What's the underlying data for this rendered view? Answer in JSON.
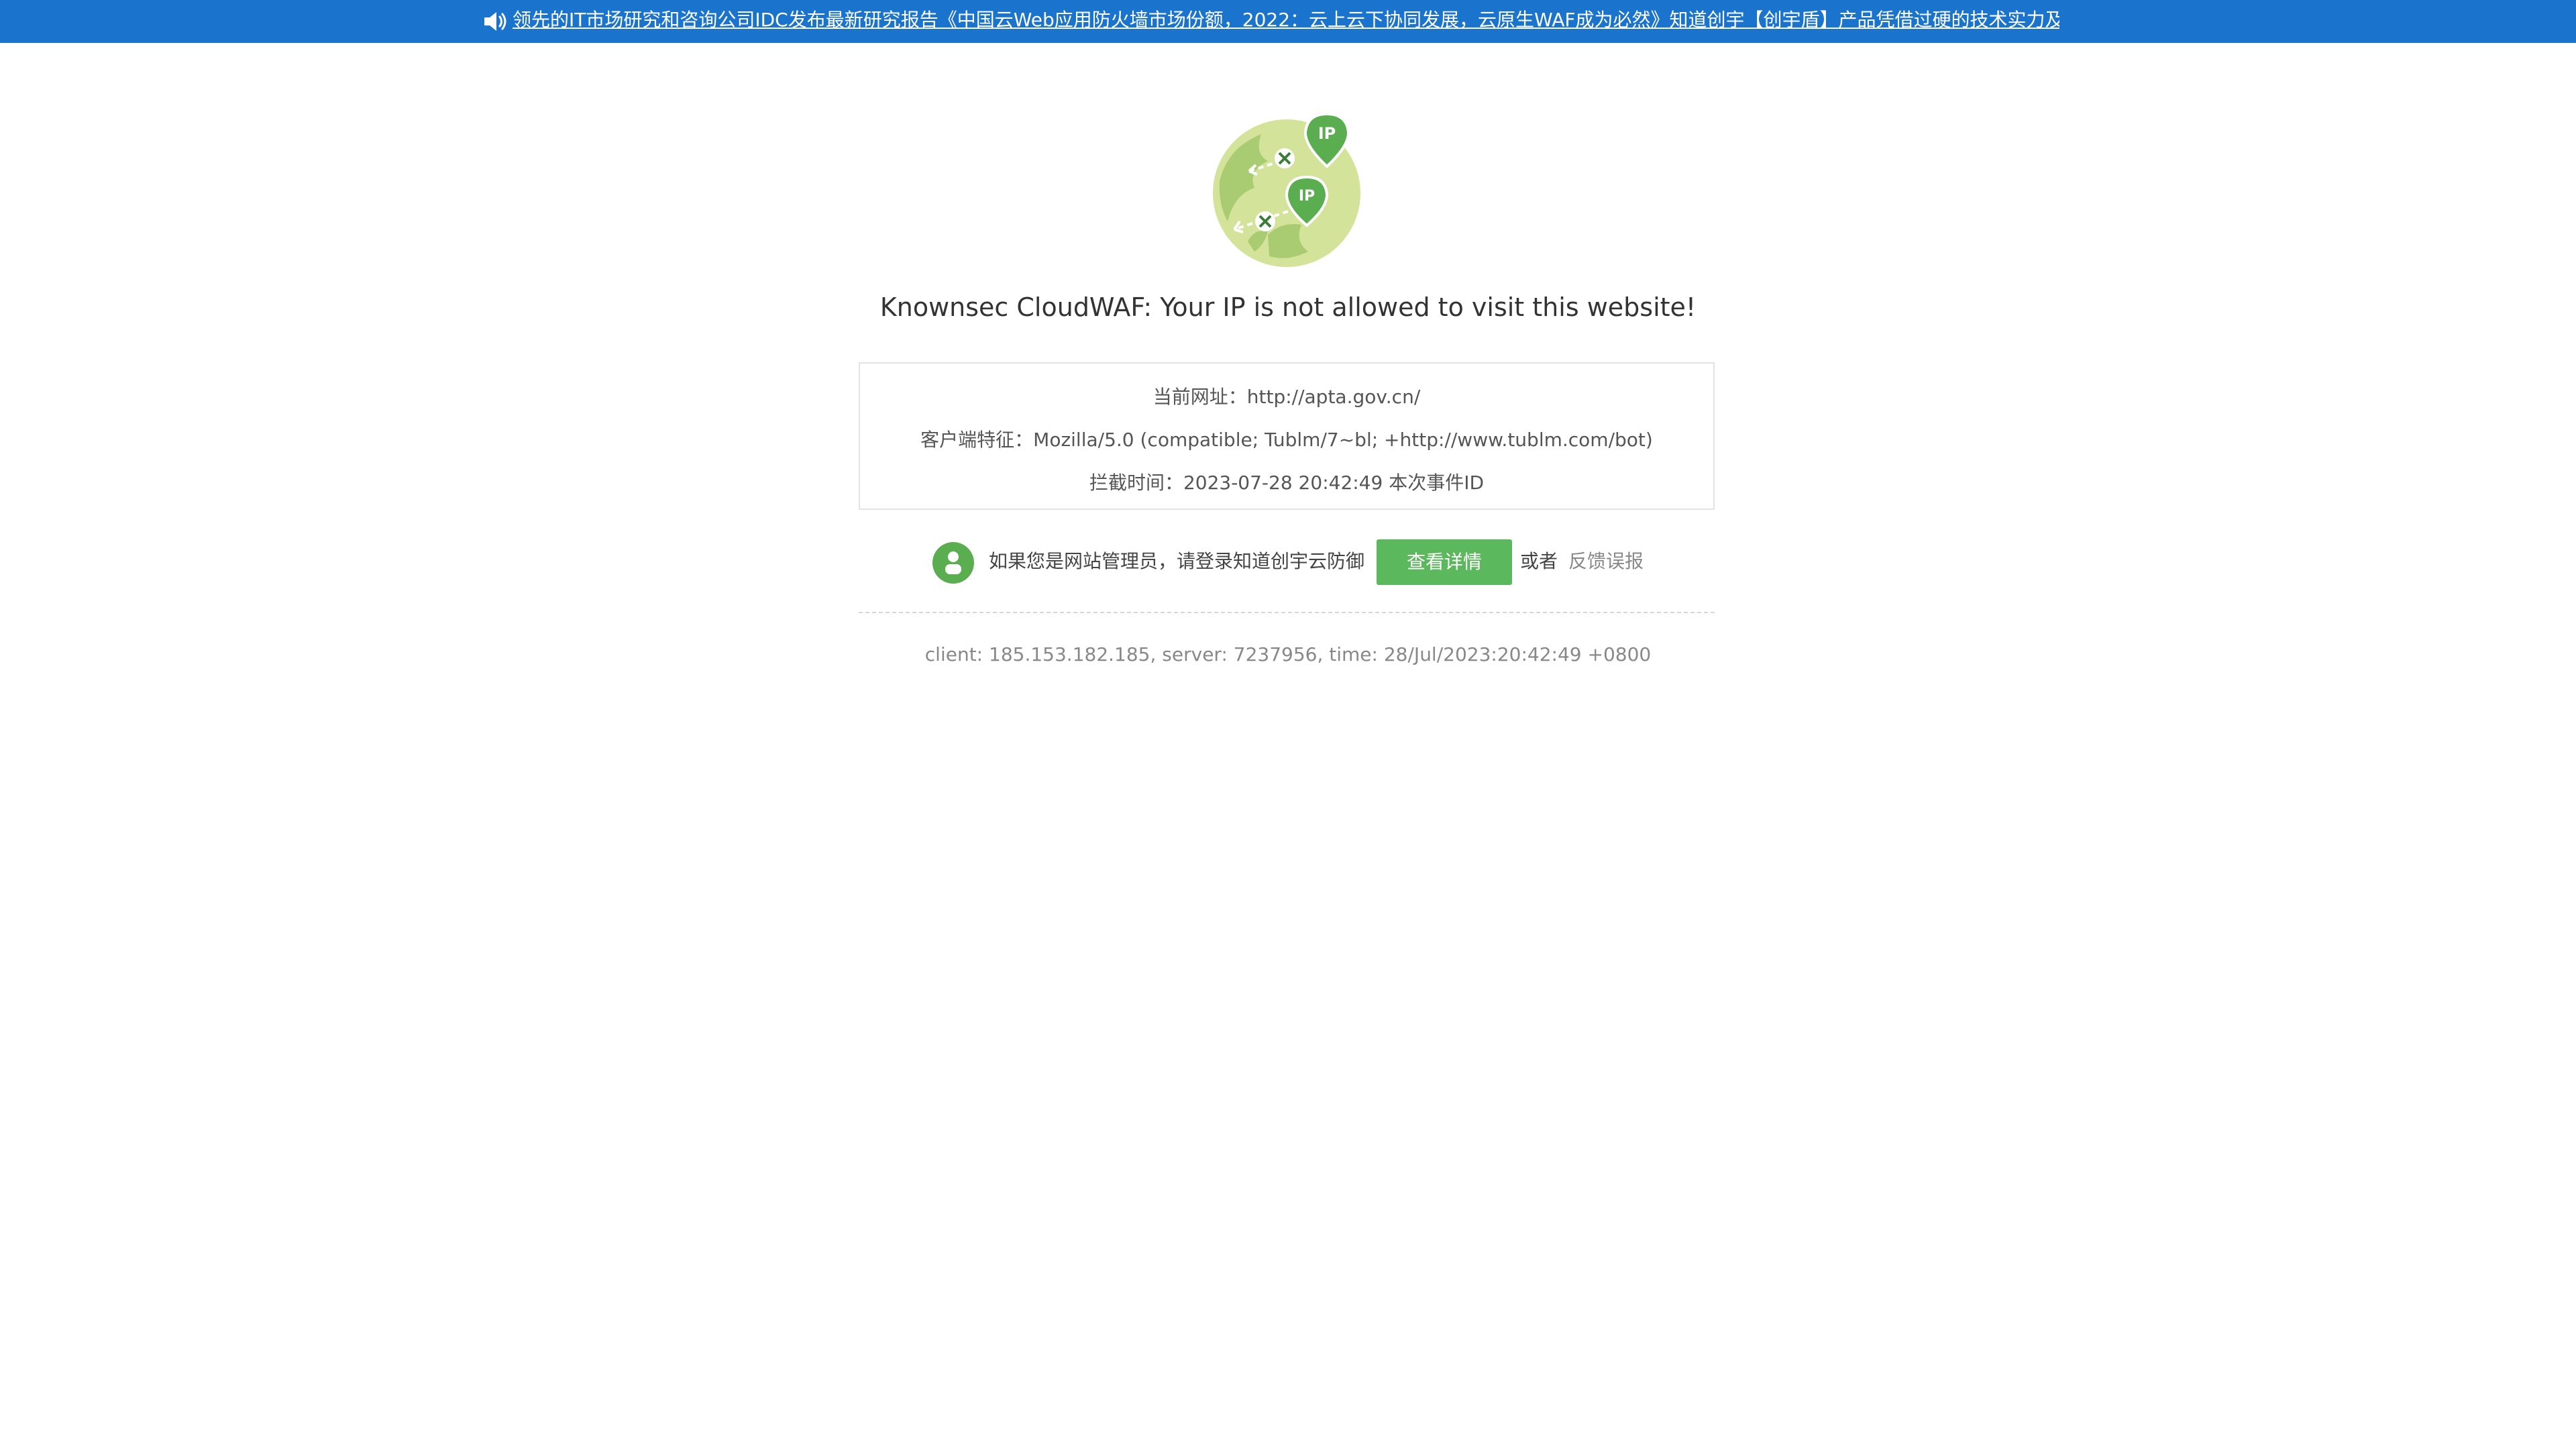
{
  "banner": {
    "icon": "speaker-icon",
    "link_text": "领先的IT市场研究和咨询公司IDC发布最新研究报告《中国云Web应用防火墙市场份额，2022：云上云下协同发展，云原生WAF成为必然》知道创宇【创宇盾】产品凭借过硬的技术实力及",
    "background_color": "#1a73cc"
  },
  "illustration": {
    "icon": "ip-blocked-globe-icon",
    "pin_label_1": "IP",
    "pin_label_2": "IP",
    "globe_color": "#d3e39a",
    "accent_color": "#5aae50"
  },
  "headline": "Knownsec CloudWAF: Your IP is not allowed to visit this website!",
  "info": {
    "current_url": "当前网址：http://apta.gov.cn/",
    "client_signature": "客户端特征：Mozilla/5.0 (compatible; Tublm/7~bl; +http://www.tublm.com/bot)",
    "block_time": "拦截时间：2023-07-28 20:42:49  本次事件ID"
  },
  "admin": {
    "icon": "user-icon",
    "prompt": "如果您是网站管理员，请登录知道创宇云防御",
    "details_button": "查看详情",
    "or": "或者",
    "feedback_link": "反馈误报",
    "button_color": "#5cb85c"
  },
  "footer_meta": "client: 185.153.182.185, server: 7237956, time: 28/Jul/2023:20:42:49 +0800"
}
